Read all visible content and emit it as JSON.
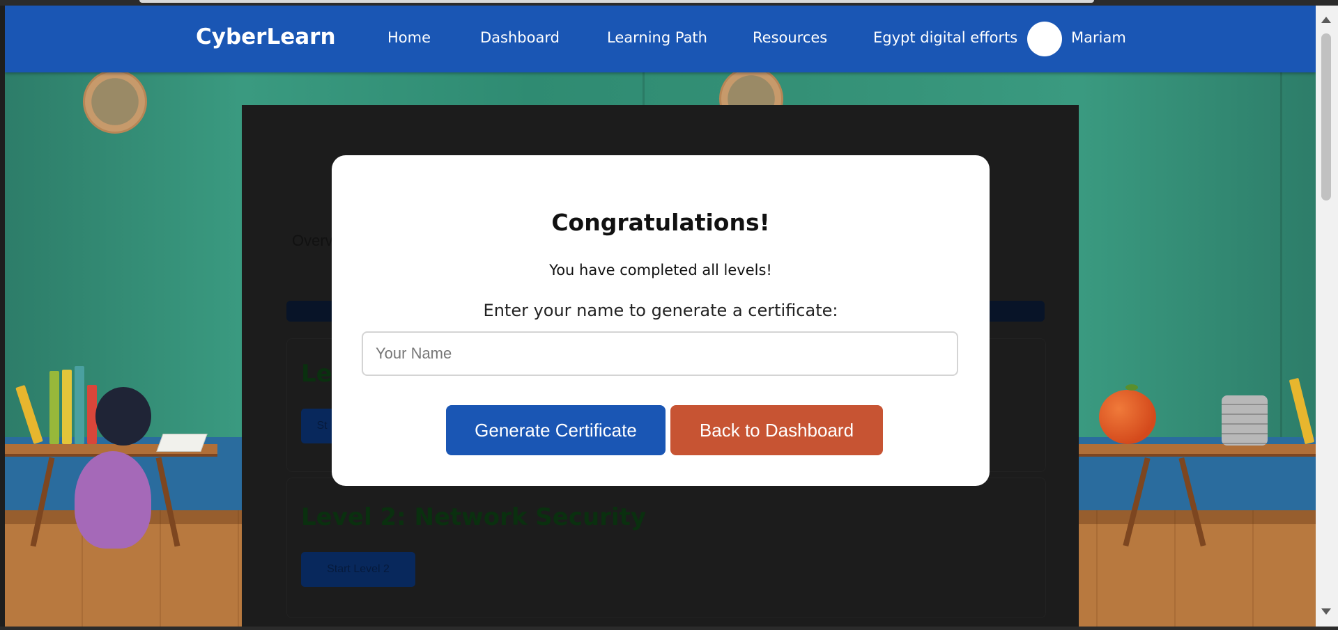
{
  "header": {
    "brand": "CyberLearn",
    "nav": [
      "Home",
      "Dashboard",
      "Learning Path",
      "Resources",
      "Egypt digital efforts"
    ],
    "username": "Mariam"
  },
  "page": {
    "overview_label": "Overv",
    "levels": [
      {
        "title": "Lev",
        "button": "St"
      },
      {
        "title": "Level 2: Network Security",
        "button": "Start Level 2"
      }
    ]
  },
  "modal": {
    "title": "Congratulations!",
    "subtitle": "You have completed all levels!",
    "prompt": "Enter your name to generate a certificate:",
    "input_placeholder": "Your Name",
    "input_value": "",
    "generate_label": "Generate Certificate",
    "back_label": "Back to Dashboard"
  },
  "colors": {
    "header": "#1a56b4",
    "primary_button": "#1a56b4",
    "secondary_button": "#c75433",
    "modal_bg": "#ffffff"
  }
}
